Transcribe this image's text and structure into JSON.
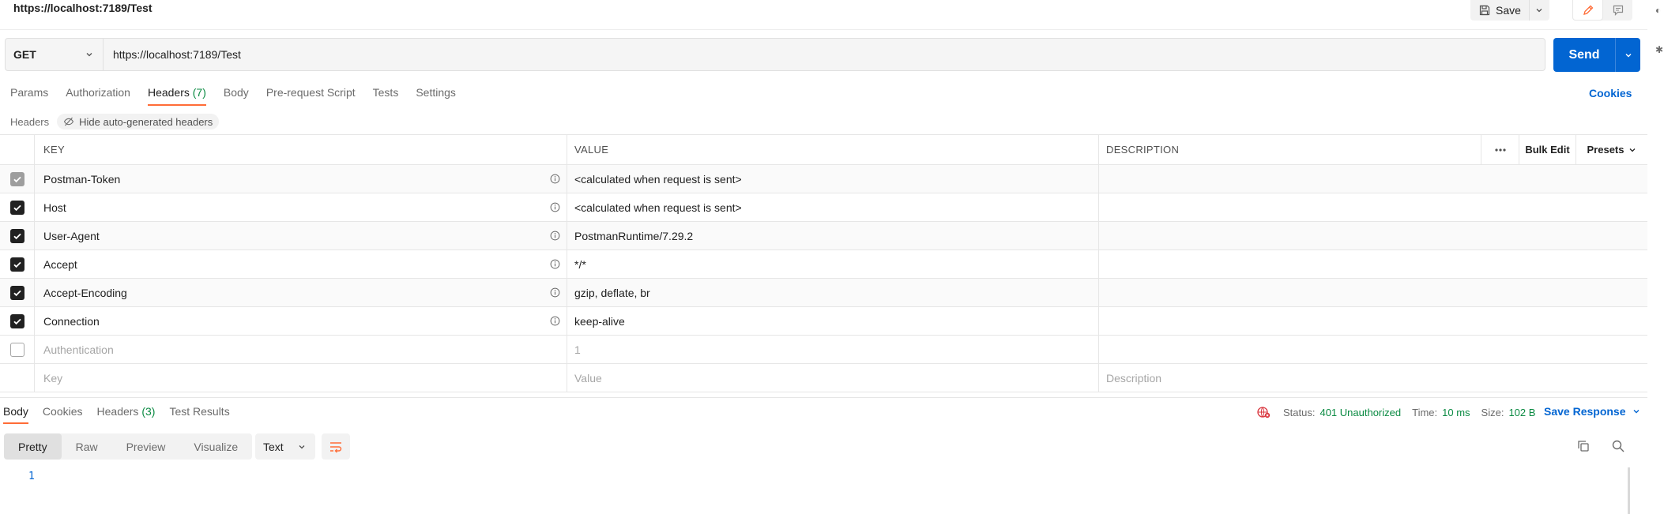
{
  "request": {
    "title": "https://localhost:7189/Test",
    "method": "GET",
    "url": "https://localhost:7189/Test"
  },
  "toolbar": {
    "save_label": "Save",
    "edit_icon": "pencil-icon",
    "comment_icon": "comment-icon"
  },
  "send": {
    "label": "Send"
  },
  "request_tabs": [
    {
      "label": "Params"
    },
    {
      "label": "Authorization"
    },
    {
      "label": "Headers",
      "count": "(7)"
    },
    {
      "label": "Body"
    },
    {
      "label": "Pre-request Script"
    },
    {
      "label": "Tests"
    },
    {
      "label": "Settings"
    }
  ],
  "cookies_link": "Cookies",
  "headers_section": {
    "label": "Headers",
    "hide_chip": "Hide auto-generated headers"
  },
  "table": {
    "columns": {
      "key": "KEY",
      "value": "VALUE",
      "description": "DESCRIPTION"
    },
    "bulk_edit": "Bulk Edit",
    "presets": "Presets",
    "rows": [
      {
        "key": "Postman-Token",
        "value": "<calculated when request is sent>",
        "state": "locked"
      },
      {
        "key": "Host",
        "value": "<calculated when request is sent>",
        "state": "checked"
      },
      {
        "key": "User-Agent",
        "value": "PostmanRuntime/7.29.2",
        "state": "checked"
      },
      {
        "key": "Accept",
        "value": "*/*",
        "state": "checked"
      },
      {
        "key": "Accept-Encoding",
        "value": "gzip, deflate, br",
        "state": "checked"
      },
      {
        "key": "Connection",
        "value": "keep-alive",
        "state": "checked"
      },
      {
        "key": "Authentication",
        "value": "1",
        "state": "unchecked"
      }
    ],
    "placeholders": {
      "key": "Key",
      "value": "Value",
      "description": "Description"
    }
  },
  "response": {
    "tabs": [
      {
        "label": "Body"
      },
      {
        "label": "Cookies"
      },
      {
        "label": "Headers",
        "count": "(3)"
      },
      {
        "label": "Test Results"
      }
    ],
    "status_label": "Status:",
    "status_value": "401 Unauthorized",
    "time_label": "Time:",
    "time_value": "10 ms",
    "size_label": "Size:",
    "size_value": "102 B",
    "save_response": "Save Response",
    "views": [
      "Pretty",
      "Raw",
      "Preview",
      "Visualize"
    ],
    "format": "Text",
    "line_number": "1"
  },
  "colors": {
    "accent": "#ff6c37",
    "primary": "#0265d2",
    "success": "#0a8a42"
  }
}
